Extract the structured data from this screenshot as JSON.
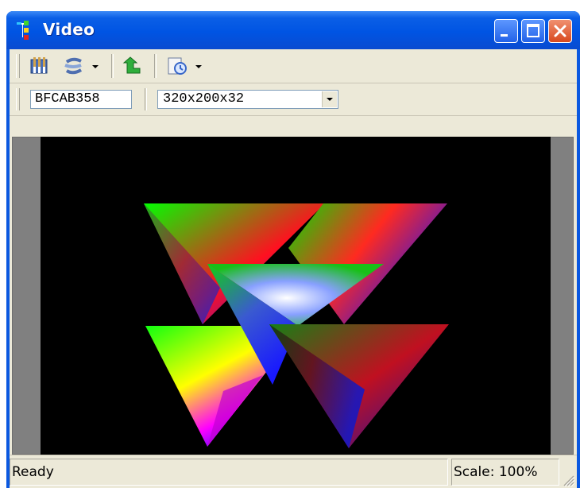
{
  "window": {
    "title": "Video"
  },
  "toolbar": {
    "buttons": [
      {
        "name": "properties-icon",
        "has_dropdown": false
      },
      {
        "name": "refresh-icon",
        "has_dropdown": true
      },
      {
        "name": "go-back-icon",
        "has_dropdown": false
      },
      {
        "name": "capture-icon",
        "has_dropdown": true
      }
    ]
  },
  "address_bar": {
    "address": "BFCAB358",
    "format": "320x200x32"
  },
  "viewport": {
    "content": "rendered 3D scene: rgb gradient shaded pyramids"
  },
  "status": {
    "text": "Ready",
    "scale": "Scale: 100%"
  },
  "colors": {
    "titlebar": "#0054e3",
    "chrome": "#ece9d8",
    "canvas_bg": "#000000",
    "viewport_bg": "#808080"
  }
}
